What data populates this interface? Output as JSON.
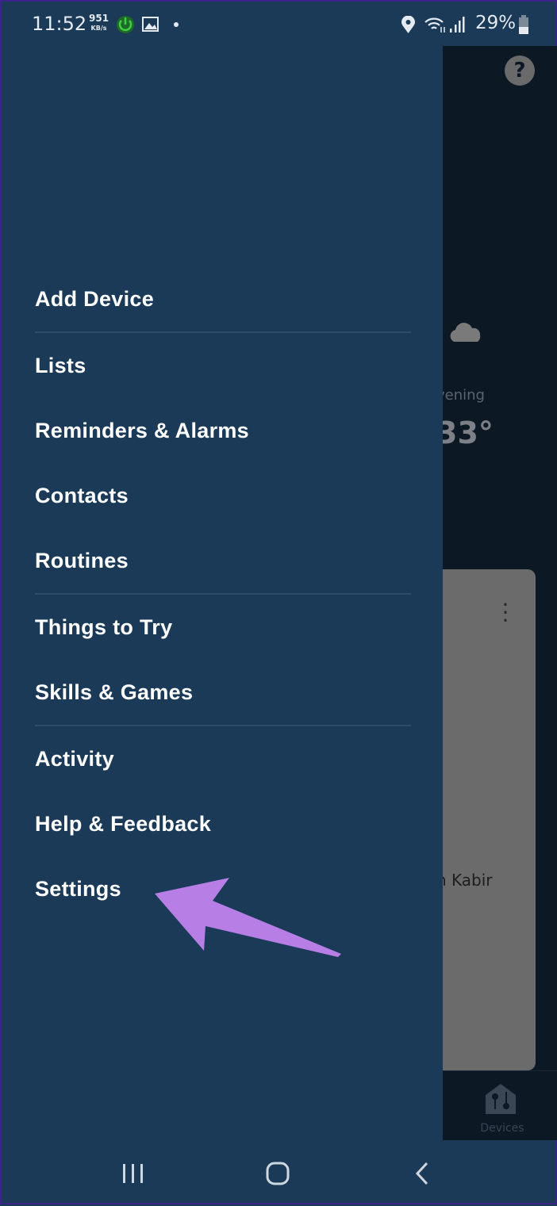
{
  "status_bar": {
    "time": "11:52",
    "speed_value": "951",
    "speed_unit": "KB/s",
    "battery": "29%"
  },
  "background": {
    "weather_period": "vening",
    "temperature": "33°",
    "card_name": "n Kabir",
    "nav_devices": "Devices"
  },
  "menu": {
    "items": [
      "Add Device",
      "Lists",
      "Reminders & Alarms",
      "Contacts",
      "Routines",
      "Things to Try",
      "Skills & Games",
      "Activity",
      "Help & Feedback",
      "Settings"
    ]
  },
  "colors": {
    "drawer": "#1a3a58",
    "annotation_arrow": "#b77fe6"
  }
}
